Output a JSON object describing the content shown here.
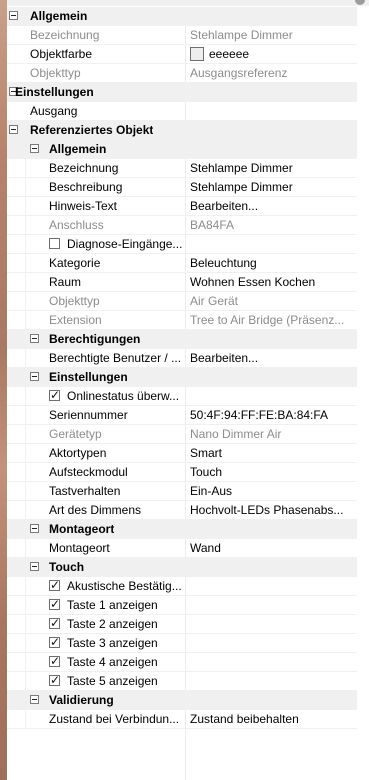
{
  "groups": {
    "allgemein": {
      "header": "Allgemein",
      "bezeichnung": {
        "name": "Bezeichnung",
        "value": "Stehlampe Dimmer"
      },
      "objektfarbe": {
        "name": "Objektfarbe",
        "value": "eeeeee",
        "color": "#eeeeee"
      },
      "objekttyp": {
        "name": "Objekttyp",
        "value": "Ausgangsreferenz"
      }
    },
    "einstellungen": {
      "header": "Einstellungen",
      "ausgang": {
        "name": "Ausgang",
        "value": ""
      }
    },
    "referenz": {
      "header": "Referenziertes Objekt",
      "allgemein": {
        "header": "Allgemein",
        "bezeichnung": {
          "name": "Bezeichnung",
          "value": "Stehlampe Dimmer"
        },
        "beschreibung": {
          "name": "Beschreibung",
          "value": "Stehlampe Dimmer"
        },
        "hinweis": {
          "name": "Hinweis-Text",
          "value": "Bearbeiten..."
        },
        "anschluss": {
          "name": "Anschluss",
          "value": "BA84FA"
        },
        "diagnose": {
          "name": "Diagnose-Eingänge...",
          "checked": false
        },
        "kategorie": {
          "name": "Kategorie",
          "value": "Beleuchtung"
        },
        "raum": {
          "name": "Raum",
          "value": "Wohnen Essen Kochen"
        },
        "objekttyp": {
          "name": "Objekttyp",
          "value": "Air Gerät"
        },
        "extension": {
          "name": "Extension",
          "value": "Tree to Air Bridge (Präsenz..."
        }
      },
      "berechtigungen": {
        "header": "Berechtigungen",
        "benutzer": {
          "name": "Berechtigte Benutzer / ...",
          "value": "Bearbeiten..."
        }
      },
      "einstellungen": {
        "header": "Einstellungen",
        "onlinestatus": {
          "name": "Onlinestatus überw...",
          "checked": true
        },
        "seriennummer": {
          "name": "Seriennummer",
          "value": "50:4F:94:FF:FE:BA:84:FA"
        },
        "geraetetyp": {
          "name": "Gerätetyp",
          "value": "Nano Dimmer Air"
        },
        "aktortypen": {
          "name": "Aktortypen",
          "value": "Smart"
        },
        "aufsteckmodul": {
          "name": "Aufsteckmodul",
          "value": "Touch"
        },
        "tastverhalten": {
          "name": "Tastverhalten",
          "value": "Ein-Aus"
        },
        "dimmen": {
          "name": "Art des Dimmens",
          "value": "Hochvolt-LEDs Phasenabs..."
        }
      },
      "montageort": {
        "header": "Montageort",
        "montageort": {
          "name": "Montageort",
          "value": "Wand"
        }
      },
      "touch": {
        "header": "Touch",
        "akustisch": {
          "name": "Akustische Bestätig...",
          "checked": true
        },
        "taste1": {
          "name": "Taste 1 anzeigen",
          "checked": true
        },
        "taste2": {
          "name": "Taste 2 anzeigen",
          "checked": true
        },
        "taste3": {
          "name": "Taste 3 anzeigen",
          "checked": true
        },
        "taste4": {
          "name": "Taste 4 anzeigen",
          "checked": true
        },
        "taste5": {
          "name": "Taste 5 anzeigen",
          "checked": true
        }
      },
      "validierung": {
        "header": "Validierung",
        "zustand": {
          "name": "Zustand bei Verbindun...",
          "value": "Zustand beibehalten"
        }
      }
    }
  },
  "icons": {
    "expander": "collapse-minus-icon",
    "checkbox": "checkbox-icon"
  },
  "colors": {
    "category_bg": "#f0f0f0",
    "readonly_text": "#8c8c8c",
    "swatch": "#eeeeee"
  }
}
